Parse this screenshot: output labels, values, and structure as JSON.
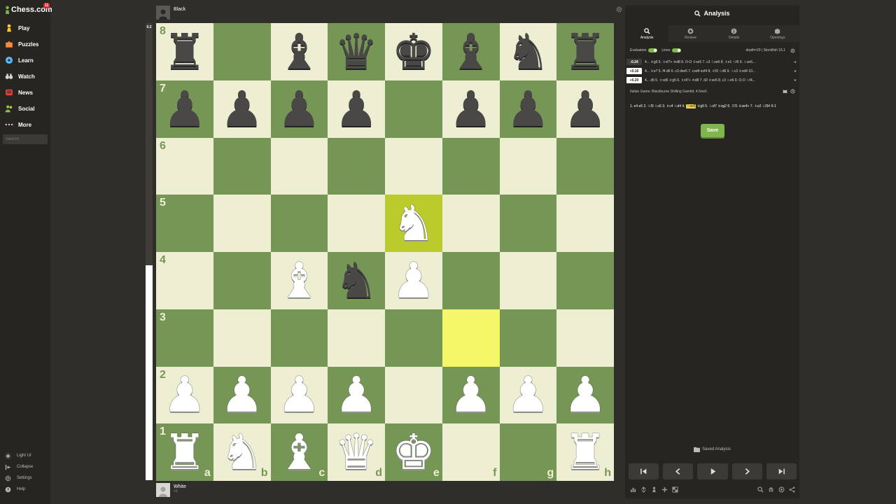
{
  "brand": {
    "name": "Chess.com",
    "notifications": "11"
  },
  "nav": [
    {
      "id": "play",
      "label": "Play",
      "icon": "play-icon",
      "color": "#f7c631"
    },
    {
      "id": "puzzles",
      "label": "Puzzles",
      "icon": "puzzle-icon",
      "color": "#f98c3b"
    },
    {
      "id": "learn",
      "label": "Learn",
      "icon": "learn-icon",
      "color": "#5ab6f0"
    },
    {
      "id": "watch",
      "label": "Watch",
      "icon": "binoculars-icon",
      "color": "#d4d4d4"
    },
    {
      "id": "news",
      "label": "News",
      "icon": "news-icon",
      "color": "#e8423f"
    },
    {
      "id": "social",
      "label": "Social",
      "icon": "social-icon",
      "color": "#7ec843"
    },
    {
      "id": "more",
      "label": "More",
      "icon": "more-icon",
      "color": "#cccccc"
    }
  ],
  "search": {
    "placeholder": "Search"
  },
  "footer": [
    {
      "id": "light-ui",
      "label": "Light UI",
      "icon": "sun-icon"
    },
    {
      "id": "collapse",
      "label": "Collapse",
      "icon": "collapse-icon"
    },
    {
      "id": "settings",
      "label": "Settings",
      "icon": "gear-icon"
    },
    {
      "id": "help",
      "label": "Help",
      "icon": "help-icon"
    }
  ],
  "eval_bar": {
    "label": "0.2",
    "white_fraction": 0.47
  },
  "players": {
    "top": {
      "name": "Black",
      "captured": ""
    },
    "bottom": {
      "name": "White",
      "captured": "+1"
    }
  },
  "board": {
    "files": [
      "a",
      "b",
      "c",
      "d",
      "e",
      "f",
      "g",
      "h"
    ],
    "ranks": [
      "8",
      "7",
      "6",
      "5",
      "4",
      "3",
      "2",
      "1"
    ],
    "colors": {
      "light": "#eeeed2",
      "dark": "#769656",
      "highlight_from": "#f6f669",
      "highlight_to": "#bbcb2b"
    },
    "last_move": {
      "from": "f3",
      "to": "e5"
    },
    "pieces": [
      {
        "sq": "a8",
        "glyph": "♜",
        "side": "b"
      },
      {
        "sq": "c8",
        "glyph": "♝",
        "side": "b"
      },
      {
        "sq": "d8",
        "glyph": "♛",
        "side": "b"
      },
      {
        "sq": "e8",
        "glyph": "♚",
        "side": "b"
      },
      {
        "sq": "f8",
        "glyph": "♝",
        "side": "b"
      },
      {
        "sq": "g8",
        "glyph": "♞",
        "side": "b"
      },
      {
        "sq": "h8",
        "glyph": "♜",
        "side": "b"
      },
      {
        "sq": "a7",
        "glyph": "♟",
        "side": "b"
      },
      {
        "sq": "b7",
        "glyph": "♟",
        "side": "b"
      },
      {
        "sq": "c7",
        "glyph": "♟",
        "side": "b"
      },
      {
        "sq": "d7",
        "glyph": "♟",
        "side": "b"
      },
      {
        "sq": "f7",
        "glyph": "♟",
        "side": "b"
      },
      {
        "sq": "g7",
        "glyph": "♟",
        "side": "b"
      },
      {
        "sq": "h7",
        "glyph": "♟",
        "side": "b"
      },
      {
        "sq": "e5",
        "glyph": "♞",
        "side": "w"
      },
      {
        "sq": "c4",
        "glyph": "♝",
        "side": "w"
      },
      {
        "sq": "d4",
        "glyph": "♞",
        "side": "b"
      },
      {
        "sq": "e4",
        "glyph": "♟",
        "side": "w"
      },
      {
        "sq": "a2",
        "glyph": "♟",
        "side": "w"
      },
      {
        "sq": "b2",
        "glyph": "♟",
        "side": "w"
      },
      {
        "sq": "c2",
        "glyph": "♟",
        "side": "w"
      },
      {
        "sq": "d2",
        "glyph": "♟",
        "side": "w"
      },
      {
        "sq": "f2",
        "glyph": "♟",
        "side": "w"
      },
      {
        "sq": "g2",
        "glyph": "♟",
        "side": "w"
      },
      {
        "sq": "h2",
        "glyph": "♟",
        "side": "w"
      },
      {
        "sq": "a1",
        "glyph": "♜",
        "side": "w"
      },
      {
        "sq": "b1",
        "glyph": "♞",
        "side": "w"
      },
      {
        "sq": "c1",
        "glyph": "♝",
        "side": "w"
      },
      {
        "sq": "d1",
        "glyph": "♛",
        "side": "w"
      },
      {
        "sq": "e1",
        "glyph": "♚",
        "side": "w"
      },
      {
        "sq": "h1",
        "glyph": "♜",
        "side": "w"
      }
    ]
  },
  "panel": {
    "title": "Analysis",
    "tabs": [
      {
        "id": "analysis",
        "label": "Analysis",
        "active": true,
        "icon": "magnifier-icon"
      },
      {
        "id": "review",
        "label": "Review",
        "active": false,
        "icon": "star-icon"
      },
      {
        "id": "details",
        "label": "Details",
        "active": false,
        "icon": "info-icon"
      },
      {
        "id": "openings",
        "label": "Openings",
        "active": false,
        "icon": "book-icon"
      }
    ],
    "evaluation_label": "Evaluation",
    "lines_label": "Lines",
    "engine": "depth=20 | Stockfish 15.1",
    "lines": [
      {
        "score": "-0.24",
        "sign": "neg",
        "text": "4... ♕g5 5. ♗xf7+ ♔d8 6. O-O ♕xe5 7. c3 ♘xe6 8. ♗e1 ♘f6 9. ♘xe6..."
      },
      {
        "score": "+0.16",
        "sign": "pos",
        "text": "4... ♕e7 5. f4 d6 6. c3 dxe5 7. cxd4 exf4 8. ♕f3 ♘d6 9. ♘c3 ♕xd4 10..."
      },
      {
        "score": "+0.20",
        "sign": "pos",
        "text": "4... d5 5. ♗xd5 ♕g5 6. ♗xf7+ ♔d8 7. d3 ♕xe5 8. c3 ♘e6 9. O-O ♘f4..."
      }
    ],
    "opening": "Italian Game: Blackburne Shilling Gambit, 4.Nxe5",
    "moves_before": "1. e4 e5 2. ♘f3 ♘c6 3. ♗c4 ♘d4 4. ",
    "current_move": "♘xe5",
    "moves_after": " ♕g5 5. ♘xf7 ♕xg2 6. ♖f1 ♕xe4+ 7. ♗e2 ♘f3# 0-1",
    "save_label": "Save",
    "saved_label": "Saved Analysis"
  }
}
